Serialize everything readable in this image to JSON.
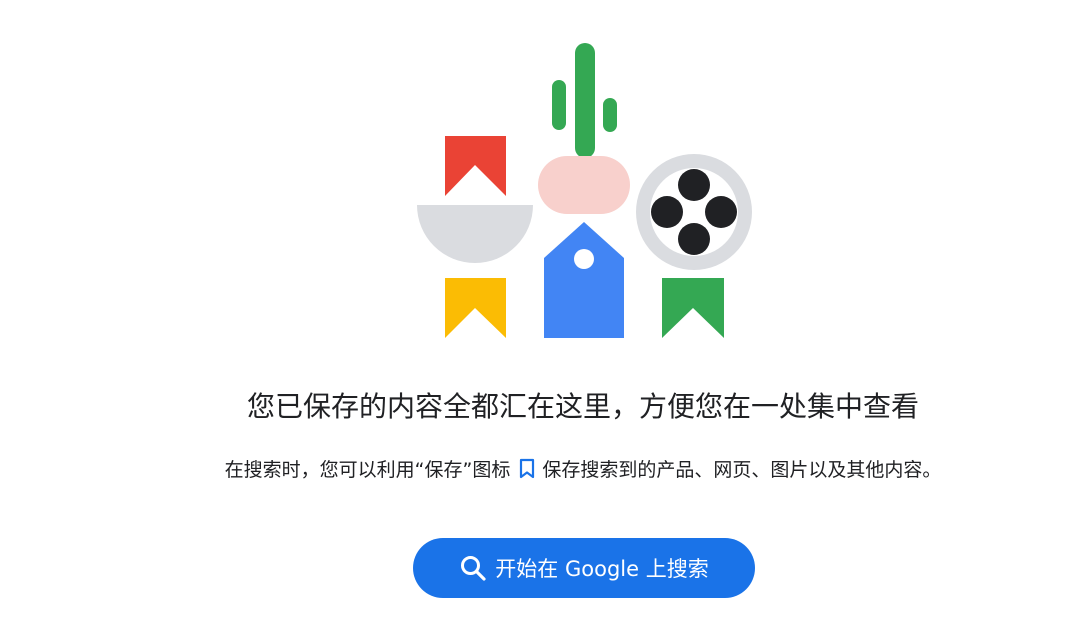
{
  "main": {
    "headline": "您已保存的内容全都汇在这里，方便您在一处集中查看",
    "description_before_icon": "在搜索时，您可以利用“保存”图标",
    "description_after_icon": "保存搜索到的产品、网页、图片以及其他内容。",
    "cta_label": "开始在 Google 上搜索"
  },
  "icons": {
    "inline_icon": "bookmark-icon",
    "cta_icon": "search-icon"
  },
  "colors": {
    "red": "#ea4335",
    "yellow": "#fbbc04",
    "green": "#34a853",
    "blue": "#4285f4",
    "gray": "#dadce0",
    "pink": "#f8d0cc",
    "button_blue": "#1a73e8",
    "text": "#202124"
  }
}
